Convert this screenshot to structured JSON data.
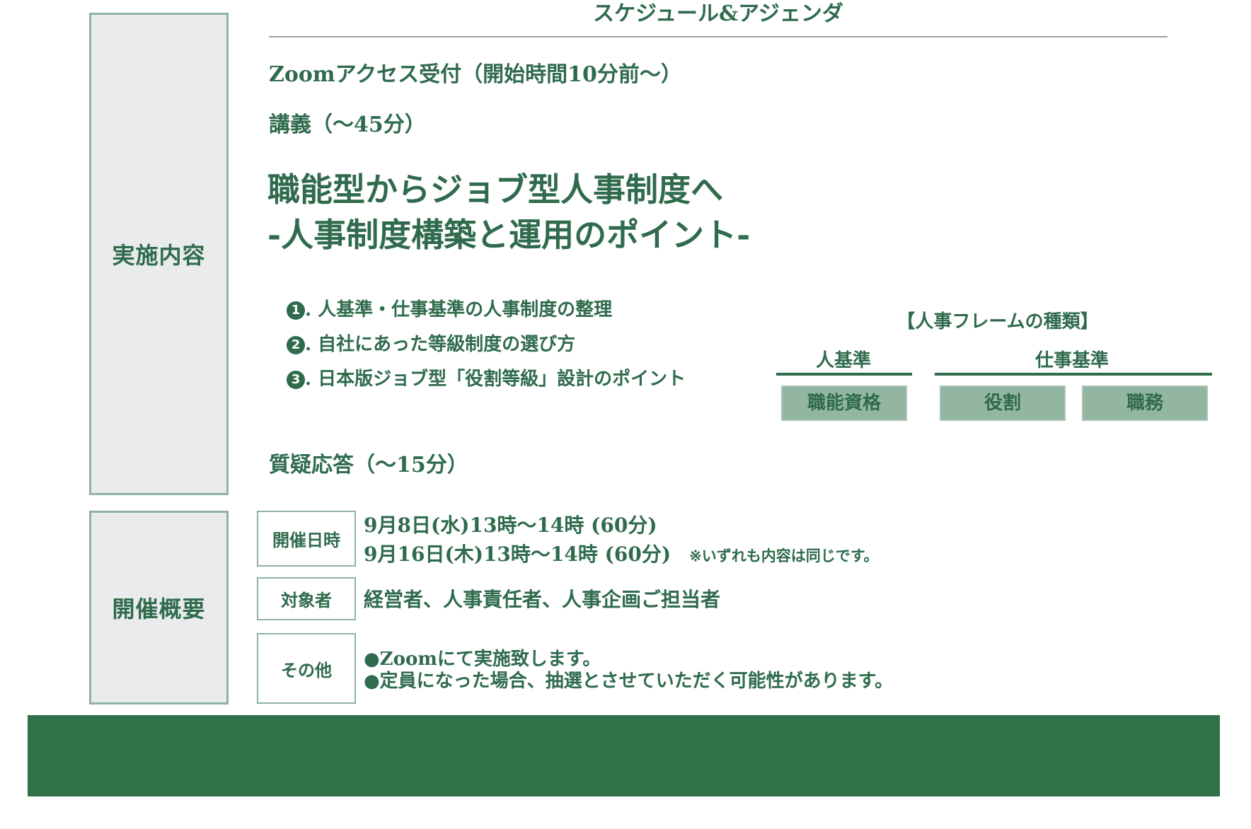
{
  "schedule": {
    "heading": "スケジュール&アジェンダ",
    "side_label": "実施内容",
    "reception": "Zoomアクセス受付（開始時間10分前〜）",
    "lecture": "講義（〜45分）",
    "title_line1": "職能型からジョブ型人事制度へ",
    "title_line2": "-人事制度構築と運用のポイント-",
    "points": [
      {
        "num": "1",
        "text": ". 人基準・仕事基準の人事制度の整理"
      },
      {
        "num": "2",
        "text": ". 自社にあった等級制度の選び方"
      },
      {
        "num": "3",
        "text": ". 日本版ジョブ型「役割等級」設計のポイント"
      }
    ],
    "qa": "質疑応答（〜15分）"
  },
  "frame": {
    "title": "【人事フレームの種類】",
    "person_basis": "人基準",
    "job_basis": "仕事基準",
    "boxes": [
      "職能資格",
      "役割",
      "職務"
    ]
  },
  "overview": {
    "side_label": "開催概要",
    "datetime_label": "開催日時",
    "date1": "9月8日(水)13時〜14時 (60分)",
    "date2": "9月16日(木)13時〜14時 (60分)",
    "note": "※いずれも内容は同じです。",
    "target_label": "対象者",
    "target_value": "経営者、人事責任者、人事企画ご担当者",
    "other_label": "その他",
    "other_line1": "●Zoomにて実施致します。",
    "other_line2": "●定員になった場合、抽選とさせていただく可能性があります。"
  },
  "colors": {
    "brand_green": "#317149",
    "text_green": "#2f6b4c",
    "box_green": "#93b6a3",
    "side_gray": "#e9ebec"
  }
}
